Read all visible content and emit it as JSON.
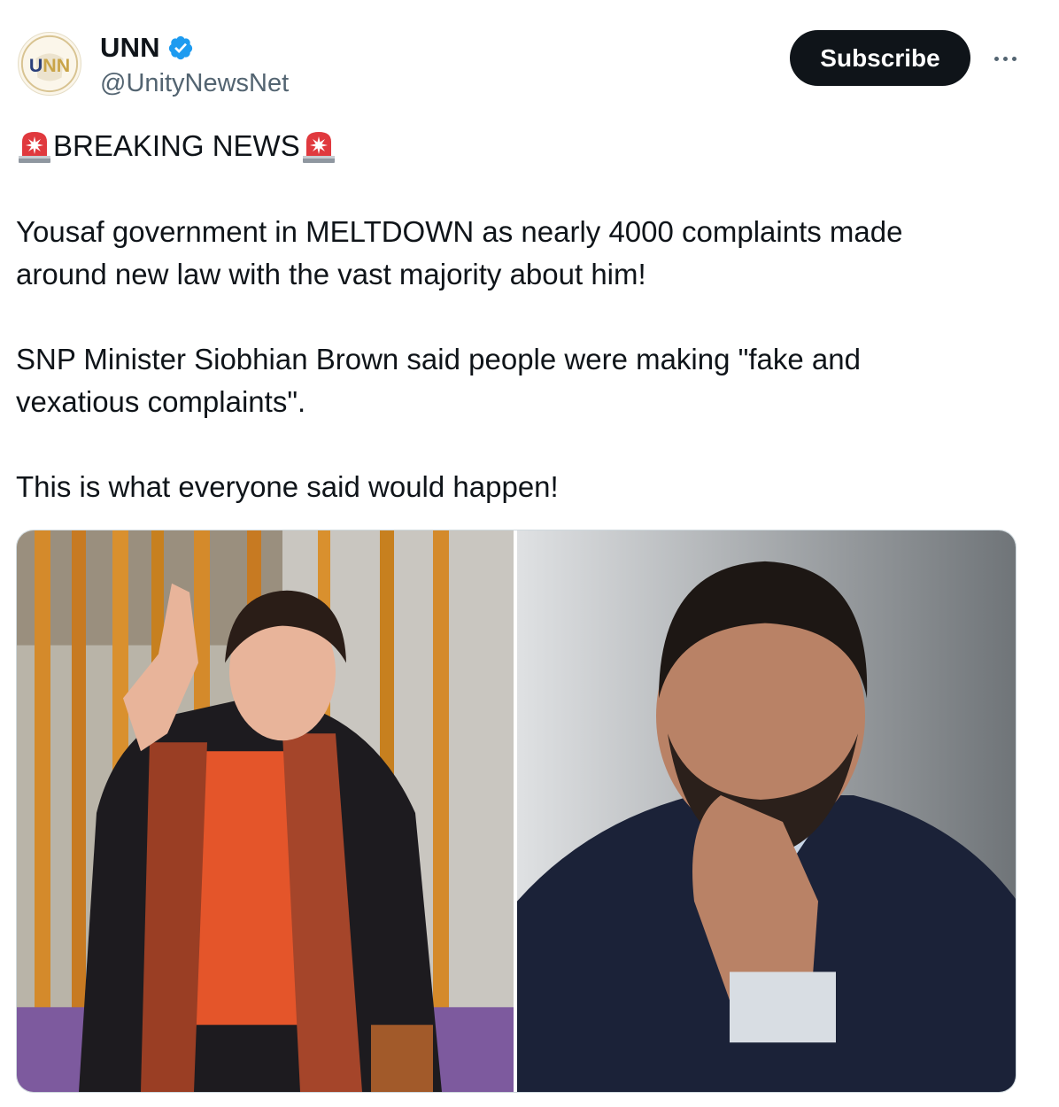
{
  "account": {
    "display_name": "UNN",
    "handle": "@UnityNewsNet",
    "avatar_text": "UNN",
    "verified_icon": "verified-badge-icon"
  },
  "actions": {
    "subscribe_label": "Subscribe",
    "more_icon": "more-horizontal-icon"
  },
  "post": {
    "breaking_emoji_icon": "police-siren-icon",
    "breaking_title": "BREAKING NEWS",
    "paragraph1_line1": "Yousaf government in MELTDOWN as nearly 4000 complaints made",
    "paragraph1_line2": "around new law with the vast majority about him!",
    "paragraph2_line1": "SNP Minister Siobhian Brown said people were making \"fake and",
    "paragraph2_line2": "vexatious complaints\".",
    "paragraph3": "This is what everyone said would happen!"
  },
  "media": {
    "photo_left": "woman-waving-photo",
    "photo_right": "man-thinking-photo"
  },
  "colors": {
    "text": "#0f1419",
    "secondary": "#536471",
    "verified": "#1d9bf0",
    "button_bg": "#0f1419",
    "border": "#cfd9de"
  }
}
